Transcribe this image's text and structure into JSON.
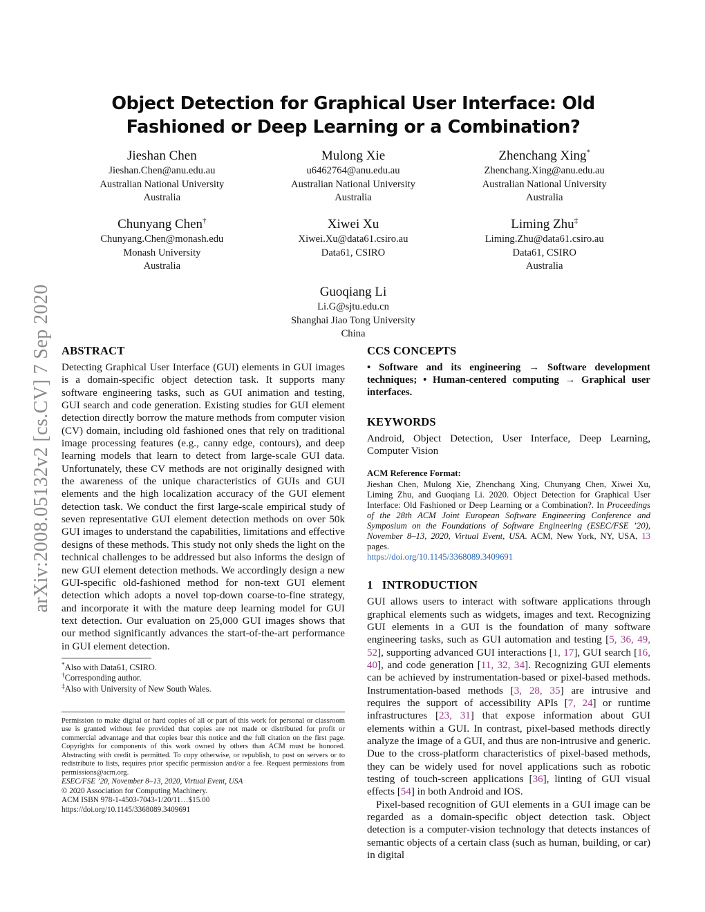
{
  "arxiv_stamp": "arXiv:2008.05132v2  [cs.CV]  7 Sep 2020",
  "title": "Object Detection for Graphical User Interface: Old Fashioned or Deep Learning or a Combination?",
  "authors": {
    "row1": [
      {
        "name": "Jieshan Chen",
        "marker": "",
        "email": "Jieshan.Chen@anu.edu.au",
        "affiliation": "Australian National University",
        "country": "Australia"
      },
      {
        "name": "Mulong Xie",
        "marker": "",
        "email": "u6462764@anu.edu.au",
        "affiliation": "Australian National University",
        "country": "Australia"
      },
      {
        "name": "Zhenchang Xing",
        "marker": "*",
        "email": "Zhenchang.Xing@anu.edu.au",
        "affiliation": "Australian National University",
        "country": "Australia"
      }
    ],
    "row2": [
      {
        "name": "Chunyang Chen",
        "marker": "†",
        "email": "Chunyang.Chen@monash.edu",
        "affiliation": "Monash University",
        "country": "Australia"
      },
      {
        "name": "Xiwei Xu",
        "marker": "",
        "email": "Xiwei.Xu@data61.csiro.au",
        "affiliation": "Data61, CSIRO",
        "country": ""
      },
      {
        "name": "Liming Zhu",
        "marker": "‡",
        "email": "Liming.Zhu@data61.csiro.au",
        "affiliation": "Data61, CSIRO",
        "country": "Australia"
      }
    ],
    "solo": {
      "name": "Guoqiang Li",
      "marker": "",
      "email": "Li.G@sjtu.edu.cn",
      "affiliation": "Shanghai Jiao Tong University",
      "country": "China"
    }
  },
  "abstract": {
    "heading": "ABSTRACT",
    "text": "Detecting Graphical User Interface (GUI) elements in GUI images is a domain-specific object detection task. It supports many software engineering tasks, such as GUI animation and testing, GUI search and code generation. Existing studies for GUI element detection directly borrow the mature methods from computer vision (CV) domain, including old fashioned ones that rely on traditional image processing features (e.g., canny edge, contours), and deep learning models that learn to detect from large-scale GUI data. Unfortunately, these CV methods are not originally designed with the awareness of the unique characteristics of GUIs and GUI elements and the high localization accuracy of the GUI element detection task. We conduct the first large-scale empirical study of seven representative GUI element detection methods on over 50k GUI images to understand the capabilities, limitations and effective designs of these methods. This study not only sheds the light on the technical challenges to be addressed but also informs the design of new GUI element detection methods. We accordingly design a new GUI-specific old-fashioned method for non-text GUI element detection which adopts a novel top-down coarse-to-fine strategy, and incorporate it with the mature deep learning model for GUI text detection. Our evaluation on 25,000 GUI images shows that our method significantly advances the start-of-the-art performance in GUI element detection."
  },
  "ccs": {
    "heading": "CCS CONCEPTS",
    "text": "• Software and its engineering → Software development techniques; • Human-centered computing → Graphical user interfaces."
  },
  "keywords": {
    "heading": "KEYWORDS",
    "text": "Android, Object Detection, User Interface, Deep Learning, Computer Vision"
  },
  "acm_reference": {
    "label": "ACM Reference Format:",
    "part1": "Jieshan Chen, Mulong Xie, Zhenchang Xing, Chunyang Chen, Xiwei Xu, Liming Zhu, and Guoqiang Li. 2020. Object Detection for Graphical User Interface: Old Fashioned or Deep Learning or a Combination?. In ",
    "italic": "Proceedings of the 28th ACM Joint European Software Engineering Conference and Symposium on the Foundations of Software Engineering (ESEC/FSE ’20), November 8–13, 2020, Virtual Event, USA",
    "part2": ". ACM, New York, NY, USA, ",
    "pages": "13",
    "part3": " pages.",
    "doi": "https://doi.org/10.1145/3368089.3409691"
  },
  "introduction": {
    "number": "1",
    "heading": "INTRODUCTION",
    "para1_a": "GUI allows users to interact with software applications through graphical elements such as widgets, images and text. Recognizing GUI elements in a GUI is the foundation of many software engineering tasks, such as GUI automation and testing [",
    "cite1": "5, 36, 49, 52",
    "para1_b": "], supporting advanced GUI interactions [",
    "cite2": "1, 17",
    "para1_c": "], GUI search [",
    "cite3": "16, 40",
    "para1_d": "], and code generation [",
    "cite4": "11, 32, 34",
    "para1_e": "]. Recognizing GUI elements can be achieved by instrumentation-based or pixel-based methods. Instrumentation-based methods [",
    "cite5": "3, 28, 35",
    "para1_f": "] are intrusive and requires the support of accessibility APIs [",
    "cite6": "7, 24",
    "para1_g": "] or runtime infrastructures [",
    "cite7": "23, 31",
    "para1_h": "] that expose information about GUI elements within a GUI. In contrast, pixel-based methods directly analyze the image of a GUI, and thus are non-intrusive and generic. Due to the cross-platform characteristics of pixel-based methods, they can be widely used for novel applications such as robotic testing of touch-screen applications [",
    "cite8": "36",
    "para1_i": "], linting of GUI visual effects [",
    "cite9": "54",
    "para1_j": "] in both Android and IOS.",
    "para2": "Pixel-based recognition of GUI elements in a GUI image can be regarded as a domain-specific object detection task. Object detection is a computer-vision technology that detects instances of semantic objects of a certain class (such as human, building, or car) in digital"
  },
  "footnotes": [
    {
      "marker": "*",
      "text": "Also with Data61, CSIRO."
    },
    {
      "marker": "†",
      "text": "Corresponding author."
    },
    {
      "marker": "‡",
      "text": "Also with University of New South Wales."
    }
  ],
  "copyright": {
    "permission": "Permission to make digital or hard copies of all or part of this work for personal or classroom use is granted without fee provided that copies are not made or distributed for profit or commercial advantage and that copies bear this notice and the full citation on the first page. Copyrights for components of this work owned by others than ACM must be honored. Abstracting with credit is permitted. To copy otherwise, or republish, to post on servers or to redistribute to lists, requires prior specific permission and/or a fee. Request permissions from permissions@acm.org.",
    "venue": "ESEC/FSE ’20, November 8–13, 2020, Virtual Event, USA",
    "holder": "© 2020 Association for Computing Machinery.",
    "isbn": "ACM ISBN 978-1-4503-7043-1/20/11…$15.00",
    "doi": "https://doi.org/10.1145/3368089.3409691"
  },
  "colors": {
    "citation": "#9c3c8d",
    "link": "#2a66b5",
    "stamp": "#8a8a8a"
  }
}
